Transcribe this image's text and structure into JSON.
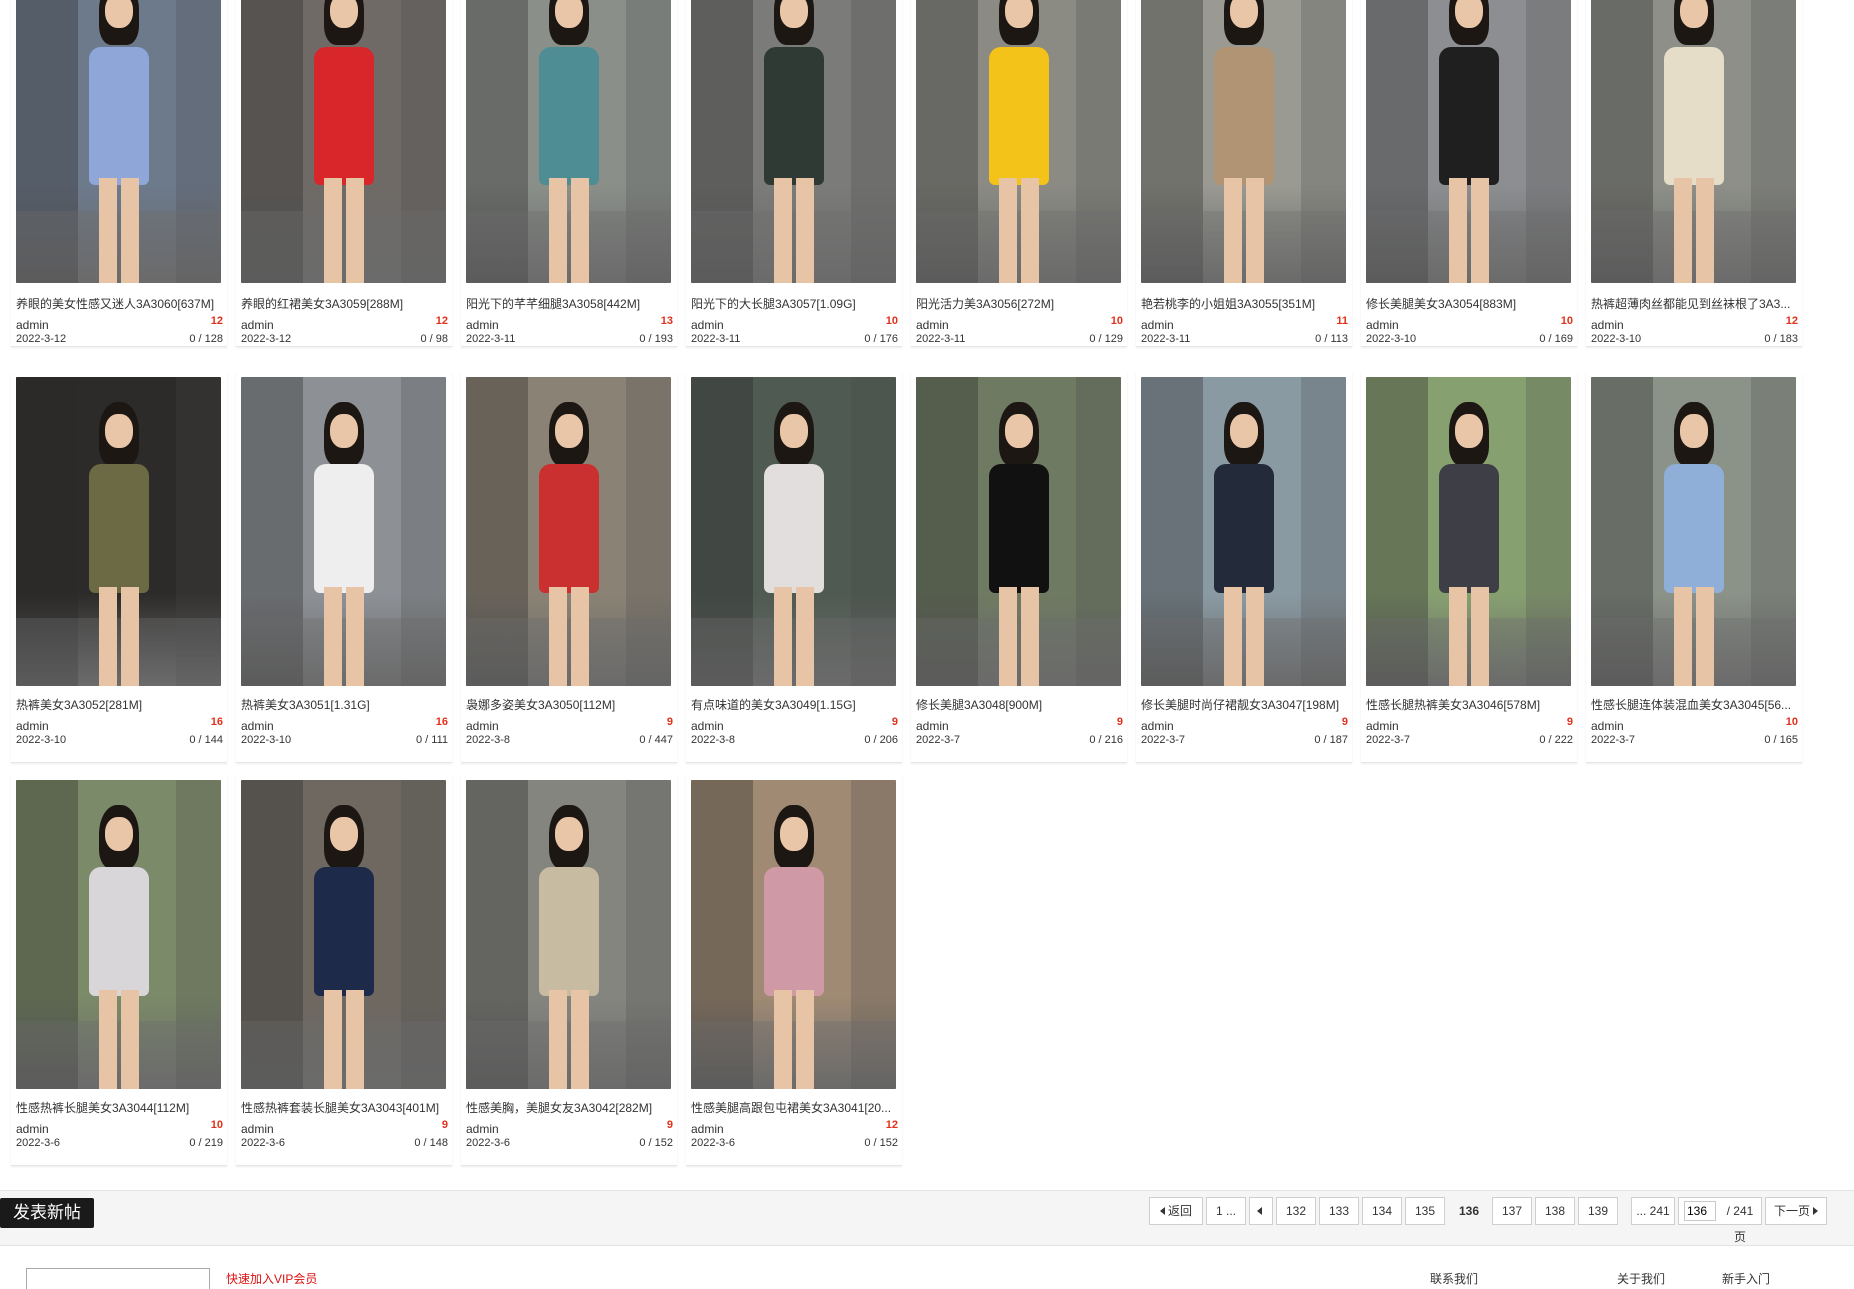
{
  "posts": [
    {
      "title": "养眼的美女性感又迷人3A3060[637M]",
      "author": "admin",
      "count": "12",
      "date": "2022-3-12",
      "views": "0 / 128",
      "colors": [
        "#6d7a8c",
        "#8ea7d8"
      ]
    },
    {
      "title": "养眼的红裙美女3A3059[288M]",
      "author": "admin",
      "count": "12",
      "date": "2022-3-12",
      "views": "0 / 98",
      "colors": [
        "#6f6a66",
        "#d8262a"
      ]
    },
    {
      "title": "阳光下的芊芊细腿3A3058[442M]",
      "author": "admin",
      "count": "13",
      "date": "2022-3-11",
      "views": "0 / 193",
      "colors": [
        "#8a8f8a",
        "#4d8d93"
      ]
    },
    {
      "title": "阳光下的大长腿3A3057[1.09G]",
      "author": "admin",
      "count": "10",
      "date": "2022-3-11",
      "views": "0 / 176",
      "colors": [
        "#7b7c79",
        "#2f3a35"
      ]
    },
    {
      "title": "阳光活力美3A3056[272M]",
      "author": "admin",
      "count": "10",
      "date": "2022-3-11",
      "views": "0 / 129",
      "colors": [
        "#8b8b84",
        "#f3c319"
      ]
    },
    {
      "title": "艳若桃李的小姐姐3A3055[351M]",
      "author": "admin",
      "count": "11",
      "date": "2022-3-11",
      "views": "0 / 113",
      "colors": [
        "#9a9a92",
        "#b09473"
      ]
    },
    {
      "title": "修长美腿美女3A3054[883M]",
      "author": "admin",
      "count": "10",
      "date": "2022-3-10",
      "views": "0 / 169",
      "colors": [
        "#8c8e91",
        "#1f1f1f"
      ]
    },
    {
      "title": "热裤超薄肉丝都能见到丝袜根了3A3...",
      "author": "admin",
      "count": "12",
      "date": "2022-3-10",
      "views": "0 / 183",
      "colors": [
        "#8d8f88",
        "#e6ddc9"
      ]
    },
    {
      "title": "热裤美女3A3052[281M]",
      "author": "admin",
      "count": "16",
      "date": "2022-3-10",
      "views": "0 / 144",
      "colors": [
        "#2d2b2a",
        "#6b6a45"
      ]
    },
    {
      "title": "热裤美女3A3051[1.31G]",
      "author": "admin",
      "count": "16",
      "date": "2022-3-10",
      "views": "0 / 111",
      "colors": [
        "#8d9196",
        "#eeeeee"
      ]
    },
    {
      "title": "袅娜多姿美女3A3050[112M]",
      "author": "admin",
      "count": "9",
      "date": "2022-3-8",
      "views": "0 / 447",
      "colors": [
        "#8a8274",
        "#cb3030"
      ]
    },
    {
      "title": "有点味道的美女3A3049[1.15G]",
      "author": "admin",
      "count": "9",
      "date": "2022-3-8",
      "views": "0 / 206",
      "colors": [
        "#4f5a52",
        "#e3dede"
      ]
    },
    {
      "title": "修长美腿3A3048[900M]",
      "author": "admin",
      "count": "9",
      "date": "2022-3-7",
      "views": "0 / 216",
      "colors": [
        "#6e7a62",
        "#111111"
      ]
    },
    {
      "title": "修长美腿时尚仔裙靓女3A3047[198M]",
      "author": "admin",
      "count": "9",
      "date": "2022-3-7",
      "views": "0 / 187",
      "colors": [
        "#8a9aa3",
        "#232a3a"
      ]
    },
    {
      "title": "性感长腿热裤美女3A3046[578M]",
      "author": "admin",
      "count": "9",
      "date": "2022-3-7",
      "views": "0 / 222",
      "colors": [
        "#87a070",
        "#3e3e46"
      ]
    },
    {
      "title": "性感长腿连体装混血美女3A3045[56...",
      "author": "admin",
      "count": "10",
      "date": "2022-3-7",
      "views": "0 / 165",
      "colors": [
        "#8b9288",
        "#8faed8"
      ]
    },
    {
      "title": "性感热裤长腿美女3A3044[112M]",
      "author": "admin",
      "count": "10",
      "date": "2022-3-6",
      "views": "0 / 219",
      "colors": [
        "#7b8a68",
        "#d9d6d9"
      ]
    },
    {
      "title": "性感热裤套装长腿美女3A3043[401M]",
      "author": "admin",
      "count": "9",
      "date": "2022-3-6",
      "views": "0 / 148",
      "colors": [
        "#6e6860",
        "#1d2a4a"
      ]
    },
    {
      "title": "性感美胸，美腿女友3A3042[282M]",
      "author": "admin",
      "count": "9",
      "date": "2022-3-6",
      "views": "0 / 152",
      "colors": [
        "#858580",
        "#c7bba2"
      ]
    },
    {
      "title": "性感美腿高跟包屯裙美女3A3041[20...",
      "author": "admin",
      "count": "12",
      "date": "2022-3-6",
      "views": "0 / 152",
      "colors": [
        "#a08a73",
        "#cf9aa6"
      ]
    }
  ],
  "new_post_label": "发表新帖",
  "pager": {
    "back": "返回",
    "first": "1 ...",
    "pages": [
      "132",
      "133",
      "134",
      "135",
      "136",
      "137",
      "138",
      "139"
    ],
    "current": "136",
    "last": "... 241",
    "input_value": "136",
    "total": "/ 241 页",
    "next": "下一页"
  },
  "footer": {
    "red_text": "快速加入VIP会员",
    "col1": "联系我们",
    "col2": "关于我们",
    "col3": "新手入门"
  }
}
